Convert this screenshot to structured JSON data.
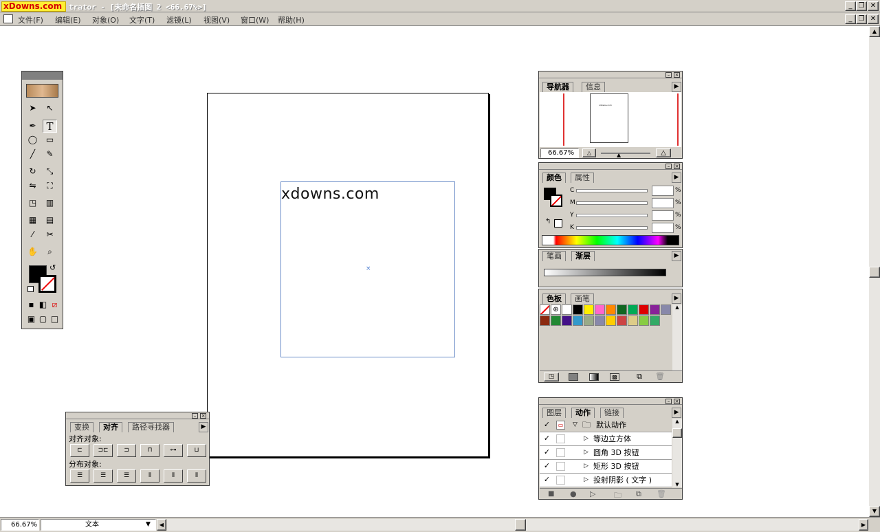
{
  "window": {
    "watermark": "xDowns.com",
    "title": "trator - [未命名插图 2 <66.67%>]"
  },
  "menu": [
    "文件(F)",
    "编辑(E)",
    "对象(O)",
    "文字(T)",
    "滤镜(L)",
    "视图(V)",
    "窗口(W)",
    "帮助(H)"
  ],
  "canvas": {
    "text": "xdowns.com"
  },
  "status": {
    "zoom": "66.67%",
    "mode": "文本"
  },
  "navigator": {
    "tabs": [
      "导航器",
      "信息"
    ],
    "zoom": "66.67%",
    "thumb_text": "xdowns.com"
  },
  "color": {
    "tabs": [
      "颜色",
      "属性"
    ],
    "channels": [
      "C",
      "M",
      "Y",
      "K"
    ],
    "unit": "%"
  },
  "stroke": {
    "tabs": [
      "笔画",
      "渐层"
    ]
  },
  "swatches": {
    "tabs": [
      "色板",
      "画笔"
    ],
    "row1": [
      "#ffffff",
      "#000000",
      "#ffee00",
      "#ff66cc",
      "#ff8800",
      "#116622",
      "#00aa55",
      "#dd0000",
      "#882299",
      "#8888aa"
    ],
    "row2": [
      "#8b2a10",
      "#228833",
      "#441188",
      "#3399cc",
      "#99aa88",
      "#8888aa",
      "#ffcc00",
      "#cc4444",
      "#ddcc88",
      "#88cc44",
      "#33aa66"
    ]
  },
  "actions": {
    "tabs": [
      "图层",
      "动作",
      "链接"
    ],
    "set": "默认动作",
    "items": [
      "等边立方体",
      "圆角 3D 按钮",
      "矩形 3D 按钮",
      "投射阴影 ( 文字 )"
    ],
    "check": "✓"
  },
  "align": {
    "tabs": [
      "变换",
      "对齐",
      "路径寻找器"
    ],
    "align_label": "对齐对象:",
    "distribute_label": "分布对象:"
  }
}
